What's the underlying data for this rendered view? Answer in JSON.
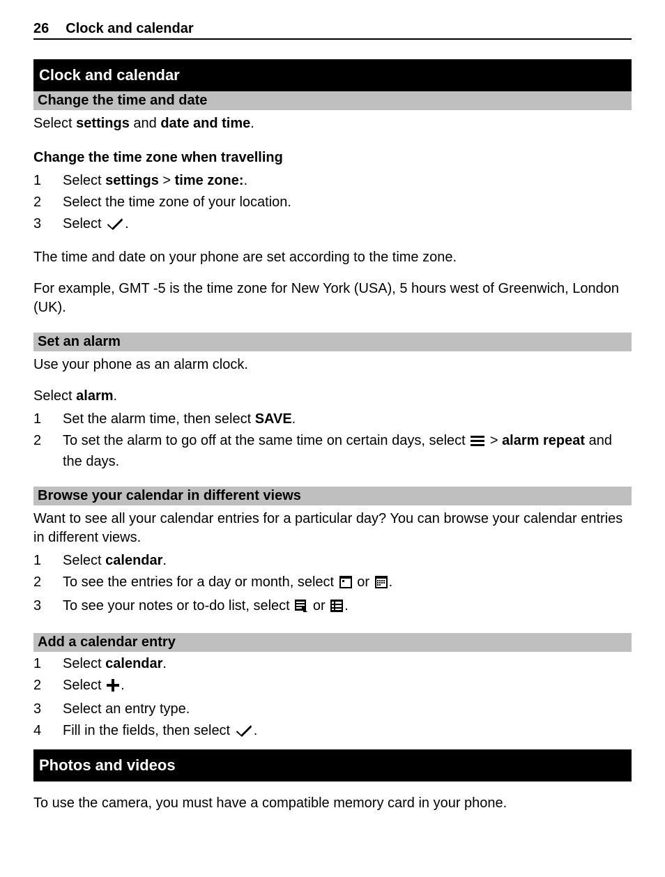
{
  "header": {
    "page_number": "26",
    "title": "Clock and calendar"
  },
  "sections": {
    "clock_calendar": {
      "title": "Clock and calendar",
      "change_time_date": {
        "heading": "Change the time and date",
        "text_prefix": "Select ",
        "settings": "settings",
        "and": " and ",
        "datetime": "date and time",
        "period": "."
      },
      "change_tz": {
        "heading": "Change the time zone when travelling",
        "step1_prefix": "Select ",
        "step1_settings": "settings",
        "step1_gt": "  > ",
        "step1_tz": "time zone:",
        "step1_period": ".",
        "step2": "Select the time zone of your location.",
        "step3_prefix": "Select ",
        "step3_period": ".",
        "note1": "The time and date on your phone are set according to the time zone.",
        "note2": "For example, GMT -5 is the time zone for New York (USA), 5 hours west of Greenwich, London (UK)."
      },
      "set_alarm": {
        "heading": "Set an alarm",
        "intro": "Use your phone as an alarm clock.",
        "select_prefix": "Select ",
        "select_alarm": "alarm",
        "select_period": ".",
        "step1_prefix": "Set the alarm time, then select ",
        "step1_save": "SAVE",
        "step1_period": ".",
        "step2_prefix": "To set the alarm to go off at the same time on certain days, select ",
        "step2_gt": "  > ",
        "step2_repeat": "alarm repeat",
        "step2_suffix": " and the days."
      },
      "browse_cal": {
        "heading": "Browse your calendar in different views",
        "intro": "Want to see all your calendar entries for a particular day? You can browse your calendar entries in different views.",
        "step1_prefix": "Select ",
        "step1_cal": "calendar",
        "step1_period": ".",
        "step2_prefix": "To see the entries for a day or month, select ",
        "step2_or": " or ",
        "step2_period": ".",
        "step3_prefix": "To see your notes or to-do list, select ",
        "step3_or": " or ",
        "step3_period": "."
      },
      "add_entry": {
        "heading": "Add a calendar entry",
        "step1_prefix": "Select ",
        "step1_cal": "calendar",
        "step1_period": ".",
        "step2_prefix": "Select ",
        "step2_period": ".",
        "step3": "Select an entry type.",
        "step4_prefix": "Fill in the fields, then select ",
        "step4_period": "."
      }
    },
    "photos_videos": {
      "title": "Photos and videos",
      "intro": "To use the camera, you must have a compatible memory card in your phone."
    }
  }
}
